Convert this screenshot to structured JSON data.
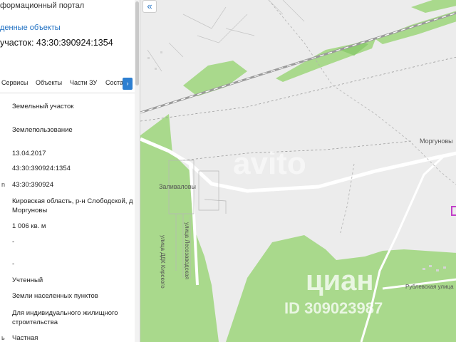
{
  "panel": {
    "portal_title": "формационный портал",
    "found_link": "денные объекты",
    "parcel_title": "участок: 43:30:390924:1354",
    "tabs": [
      "Сервисы",
      "Объекты",
      "Части ЗУ",
      "Соста"
    ],
    "tab_arrow": "›",
    "rows": [
      {
        "label": "",
        "value": "Земельный участок"
      },
      {
        "label": "",
        "value": "Землепользование"
      },
      {
        "label": "",
        "value": "13.04.2017"
      },
      {
        "label": "",
        "value": "43:30:390924:1354"
      },
      {
        "label": "n",
        "value": "43:30:390924"
      },
      {
        "label": "",
        "value": "Кировская область, р-н Слободской, д Моргуновы"
      },
      {
        "label": "",
        "value": "1 006 кв. м"
      },
      {
        "label": "",
        "value": "-"
      },
      {
        "label": "",
        "value": "-"
      },
      {
        "label": "",
        "value": "Учтенный"
      },
      {
        "label": "",
        "value": "Земли населенных пунктов"
      },
      {
        "label": "",
        "value": "Для индивидуального жилищного строительства"
      },
      {
        "label": "ь",
        "value": "Частная"
      }
    ]
  },
  "map": {
    "collapse_label": "«",
    "labels": {
      "morgunovy": "Моргуновы",
      "zalivalovy": "Заливаловы",
      "street_lumber": "улица Лесозаводская",
      "street_ddk": "улица ДДК Кирского",
      "street_rublevskaya": "Рублевская улица"
    },
    "watermark_brand": "циан",
    "watermark_id": "ID 309023987",
    "watermark_avito": "avito",
    "colors": {
      "map_bg": "#ececec",
      "forest": "#a9d98c",
      "forest_dark": "#8fcc72",
      "road": "#ffffff",
      "rail": "#9a9a9a",
      "marker": "#c23fc9",
      "accent": "#2d7fd1"
    }
  }
}
